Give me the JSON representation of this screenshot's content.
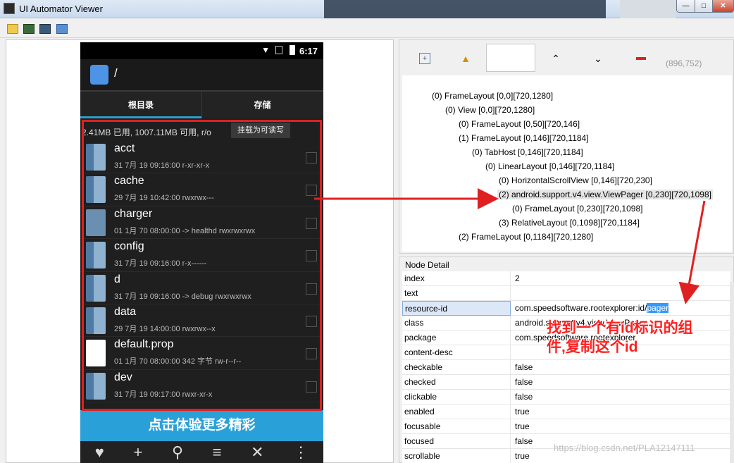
{
  "window": {
    "title": "UI Automator Viewer",
    "minimize": "—",
    "maximize": "□",
    "close": "✕"
  },
  "toolbar": {
    "icons": [
      "folder-open-icon",
      "device-screenshot-icon",
      "device-screenshot-compressed-icon",
      "save-icon"
    ]
  },
  "phone": {
    "time": "6:17",
    "path": "/",
    "tabs": [
      "根目录",
      "存储"
    ],
    "storage_info": "2.41MB 已用, 1007.11MB 可用, r/o",
    "rw_button": "挂载为可读写",
    "files": [
      {
        "name": "acct",
        "meta": "31 7月 19 09:16:00    r-xr-xr-x",
        "type": "folder"
      },
      {
        "name": "cache",
        "meta": "29 7月 19 10:42:00    rwxrwx---",
        "type": "folder"
      },
      {
        "name": "charger",
        "meta": "01 1月 70 08:00:00  -> healthd  rwxrwxrwx",
        "type": "file"
      },
      {
        "name": "config",
        "meta": "31 7月 19 09:16:00    r-x------",
        "type": "folder"
      },
      {
        "name": "d",
        "meta": "31 7月 19 09:16:00  -> debug  rwxrwxrwx",
        "type": "folder"
      },
      {
        "name": "data",
        "meta": "29 7月 19 14:00:00    rwxrwx--x",
        "type": "folder"
      },
      {
        "name": "default.prop",
        "meta": "01 1月 70 08:00:00  342 字节   rw-r--r--",
        "type": "doc"
      },
      {
        "name": "dev",
        "meta": "31 7月 19 09:17:00    rwxr-xr-x",
        "type": "folder"
      }
    ],
    "banner": "点击体验更多精彩",
    "bottom_icons": [
      "♥",
      "+",
      "⚲",
      "≡",
      "✕",
      "⋮"
    ]
  },
  "hierarchy": {
    "coord": "(896,752)",
    "nodes": [
      "(0) FrameLayout [0,0][720,1280]",
      "(0) View [0,0][720,1280]",
      "(0) FrameLayout [0,50][720,146]",
      "(1) FrameLayout [0,146][720,1184]",
      "(0) TabHost [0,146][720,1184]",
      "(0) LinearLayout [0,146][720,1184]",
      "(0) HorizontalScrollView [0,146][720,230]",
      "(2) android.support.v4.view.ViewPager [0,230][720,1098]",
      "(0) FrameLayout [0,230][720,1098]",
      "(3) RelativeLayout [0,1098][720,1184]",
      "(2) FrameLayout [0,1184][720,1280]"
    ]
  },
  "node_detail": {
    "title": "Node Detail",
    "rows": [
      {
        "k": "index",
        "v": "2"
      },
      {
        "k": "text",
        "v": ""
      },
      {
        "k": "resource-id",
        "v": "com.speedsoftware.rootexplorer:id/"
      },
      {
        "k": "class",
        "v": "android.support.v4.view.ViewPager"
      },
      {
        "k": "package",
        "v": "com.speedsoftware.rootexplorer"
      },
      {
        "k": "content-desc",
        "v": ""
      },
      {
        "k": "checkable",
        "v": "false"
      },
      {
        "k": "checked",
        "v": "false"
      },
      {
        "k": "clickable",
        "v": "false"
      },
      {
        "k": "enabled",
        "v": "true"
      },
      {
        "k": "focusable",
        "v": "true"
      },
      {
        "k": "focused",
        "v": "false"
      },
      {
        "k": "scrollable",
        "v": "true"
      }
    ],
    "resource_id_highlight": "pager"
  },
  "annotation": {
    "line1": "找到一个有id标识的组",
    "line2": "件,复制这个id"
  },
  "watermark": "https://blog.csdn.net/PLA12147111",
  "colors": {
    "annotation_red": "#e02020",
    "selection_blue": "#3399ff",
    "tab_accent": "#2aa0c9",
    "banner_blue": "#2aa0d8"
  }
}
